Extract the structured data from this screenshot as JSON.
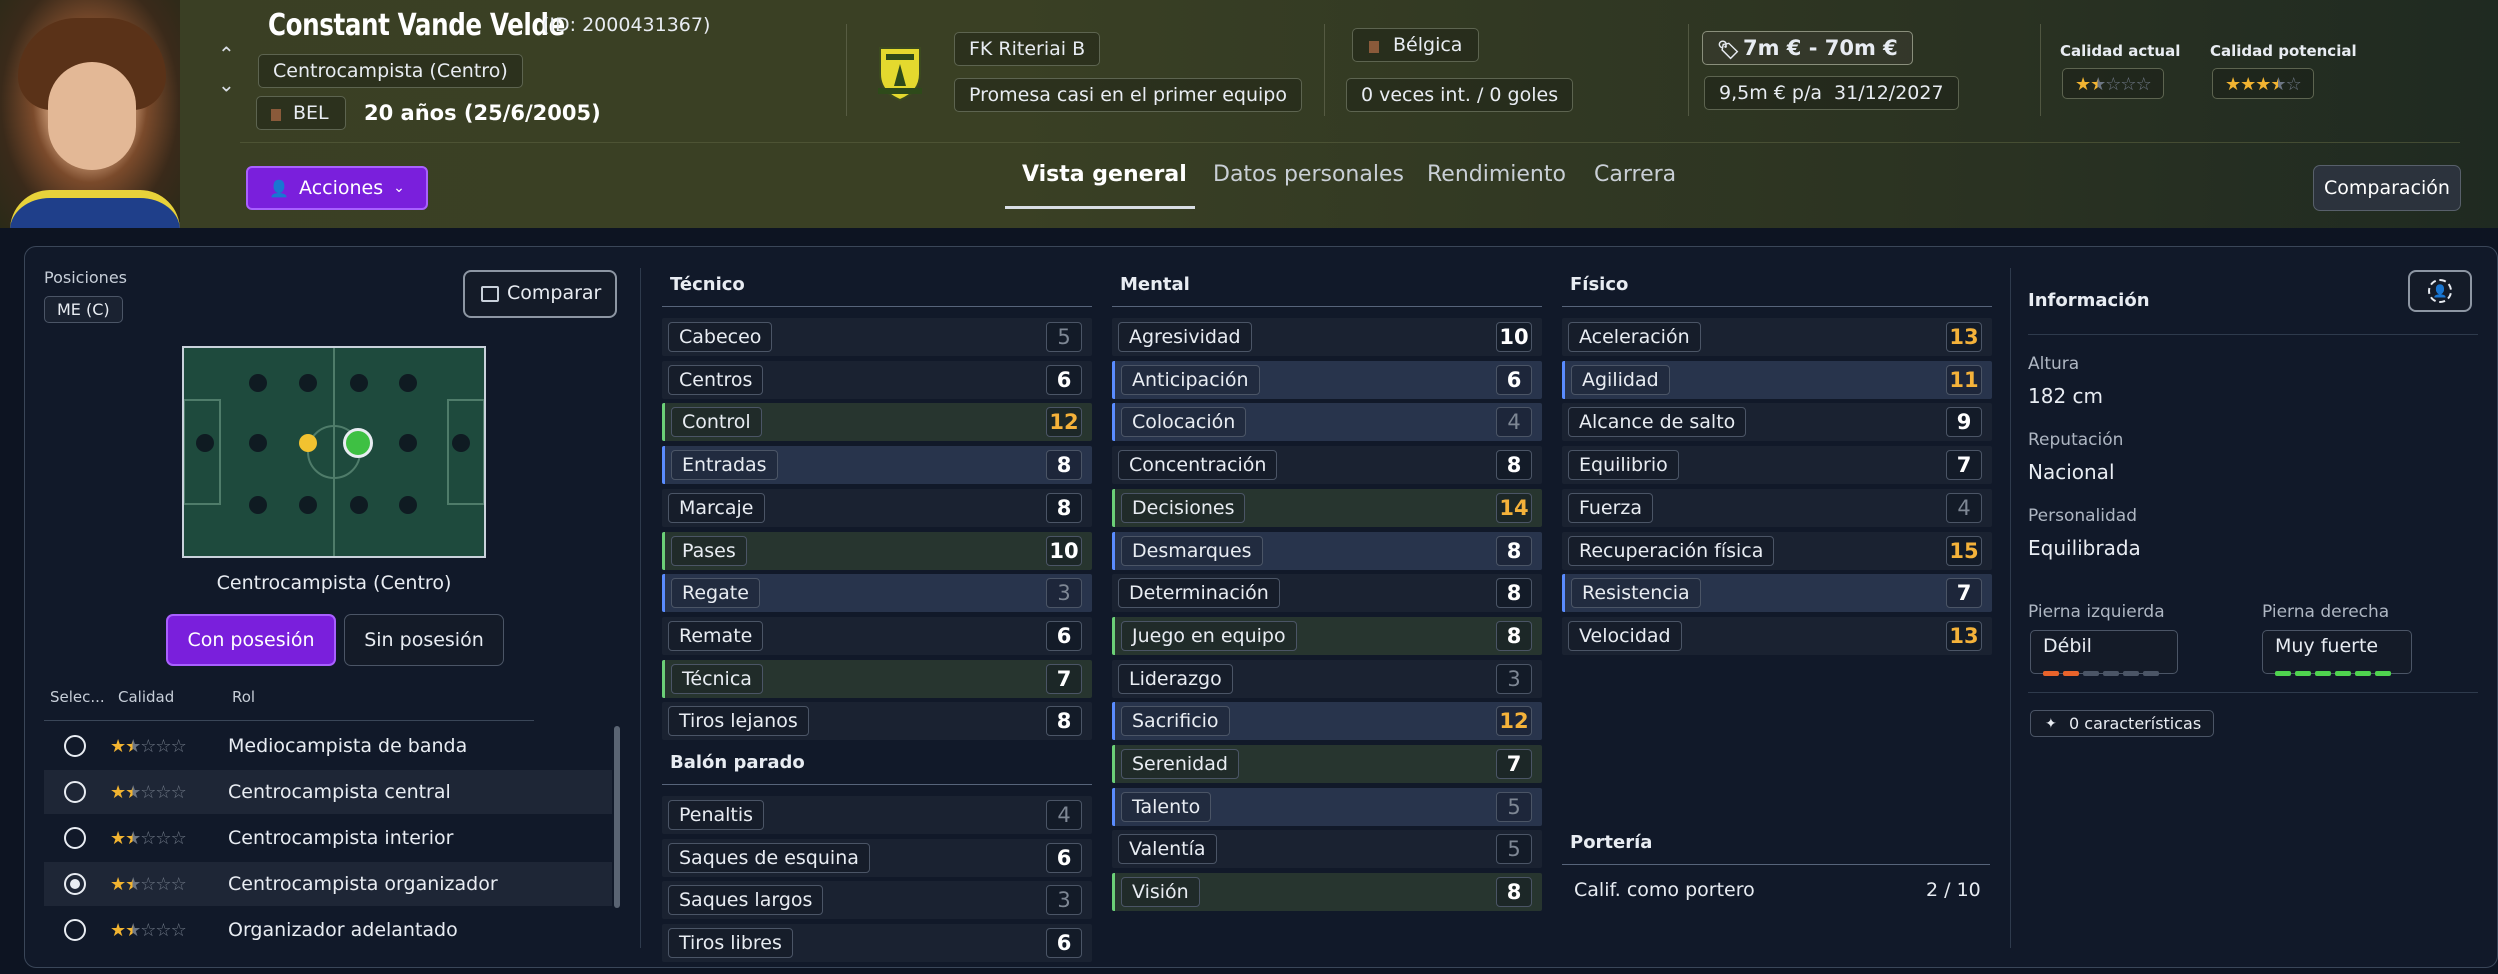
{
  "player": {
    "name": "Constant Vande Velde",
    "id": "(ID: 2000431367)",
    "position": "Centrocampista (Centro)",
    "nationality_code": "BEL",
    "age": "20 años (25/6/2005)"
  },
  "club": {
    "name": "FK Riteriai B",
    "status": "Promesa casi en el primer equipo"
  },
  "country": {
    "name": "Bélgica",
    "caps": "0 veces int. / 0 goles"
  },
  "value": {
    "range": "7m € - 70m €",
    "wage": "9,5m € p/a",
    "contract_end": "31/12/2027"
  },
  "ability": {
    "current_label": "Calidad actual",
    "potential_label": "Calidad potencial",
    "current_stars": 1.5,
    "potential_stars": 3.5
  },
  "actions_label": "Acciones",
  "tabs": [
    "Vista general",
    "Datos personales",
    "Rendimiento",
    "Carrera"
  ],
  "comparison_label": "Comparación",
  "positions": {
    "label": "Posiciones",
    "badge": "ME (C)",
    "compare_label": "Comparar",
    "pitch_label": "Centrocampista (Centro)",
    "in_possession": "Con posesión",
    "out_possession": "Sin posesión"
  },
  "roles": {
    "headers": [
      "Selec...",
      "Calidad",
      "Rol"
    ],
    "items": [
      {
        "name": "Mediocampista de banda",
        "stars": 1.5,
        "selected": false
      },
      {
        "name": "Centrocampista central",
        "stars": 1.5,
        "selected": false
      },
      {
        "name": "Centrocampista interior",
        "stars": 1.5,
        "selected": false
      },
      {
        "name": "Centrocampista organizador",
        "stars": 1.5,
        "selected": true
      },
      {
        "name": "Organizador adelantado",
        "stars": 1.5,
        "selected": false
      }
    ]
  },
  "technical": {
    "title": "Técnico",
    "items": [
      {
        "name": "Cabeceo",
        "value": "5"
      },
      {
        "name": "Centros",
        "value": "6"
      },
      {
        "name": "Control",
        "value": "12"
      },
      {
        "name": "Entradas",
        "value": "8"
      },
      {
        "name": "Marcaje",
        "value": "8"
      },
      {
        "name": "Pases",
        "value": "10"
      },
      {
        "name": "Regate",
        "value": "3"
      },
      {
        "name": "Remate",
        "value": "6"
      },
      {
        "name": "Técnica",
        "value": "7"
      },
      {
        "name": "Tiros lejanos",
        "value": "8"
      }
    ]
  },
  "set_pieces": {
    "title": "Balón parado",
    "items": [
      {
        "name": "Penaltis",
        "value": "4"
      },
      {
        "name": "Saques de esquina",
        "value": "6"
      },
      {
        "name": "Saques largos",
        "value": "3"
      },
      {
        "name": "Tiros libres",
        "value": "6"
      }
    ]
  },
  "mental": {
    "title": "Mental",
    "items": [
      {
        "name": "Agresividad",
        "value": "10"
      },
      {
        "name": "Anticipación",
        "value": "6"
      },
      {
        "name": "Colocación",
        "value": "4"
      },
      {
        "name": "Concentración",
        "value": "8"
      },
      {
        "name": "Decisiones",
        "value": "14"
      },
      {
        "name": "Desmarques",
        "value": "8"
      },
      {
        "name": "Determinación",
        "value": "8"
      },
      {
        "name": "Juego en equipo",
        "value": "8"
      },
      {
        "name": "Liderazgo",
        "value": "3"
      },
      {
        "name": "Sacrificio",
        "value": "12"
      },
      {
        "name": "Serenidad",
        "value": "7"
      },
      {
        "name": "Talento",
        "value": "5"
      },
      {
        "name": "Valentía",
        "value": "5"
      },
      {
        "name": "Visión",
        "value": "8"
      }
    ]
  },
  "physical": {
    "title": "Físico",
    "items": [
      {
        "name": "Aceleración",
        "value": "13"
      },
      {
        "name": "Agilidad",
        "value": "11"
      },
      {
        "name": "Alcance de salto",
        "value": "9"
      },
      {
        "name": "Equilibrio",
        "value": "7"
      },
      {
        "name": "Fuerza",
        "value": "4"
      },
      {
        "name": "Recuperación física",
        "value": "15"
      },
      {
        "name": "Resistencia",
        "value": "7"
      },
      {
        "name": "Velocidad",
        "value": "13"
      }
    ]
  },
  "goalkeeping": {
    "title": "Portería",
    "label": "Calif. como portero",
    "value": "2 / 10"
  },
  "info": {
    "title": "Información",
    "height_label": "Altura",
    "height": "182 cm",
    "reputation_label": "Reputación",
    "reputation": "Nacional",
    "personality_label": "Personalidad",
    "personality": "Equilibrada",
    "left_foot_label": "Pierna izquierda",
    "left_foot": "Débil",
    "left_foot_level": 2,
    "right_foot_label": "Pierna derecha",
    "right_foot": "Muy fuerte",
    "right_foot_level": 6,
    "traits": "0 características"
  },
  "colors": {
    "accent": "#7a1fdc",
    "highlight": "#f4b23a",
    "green": "#6bcf77",
    "blue": "#5a8cff"
  }
}
